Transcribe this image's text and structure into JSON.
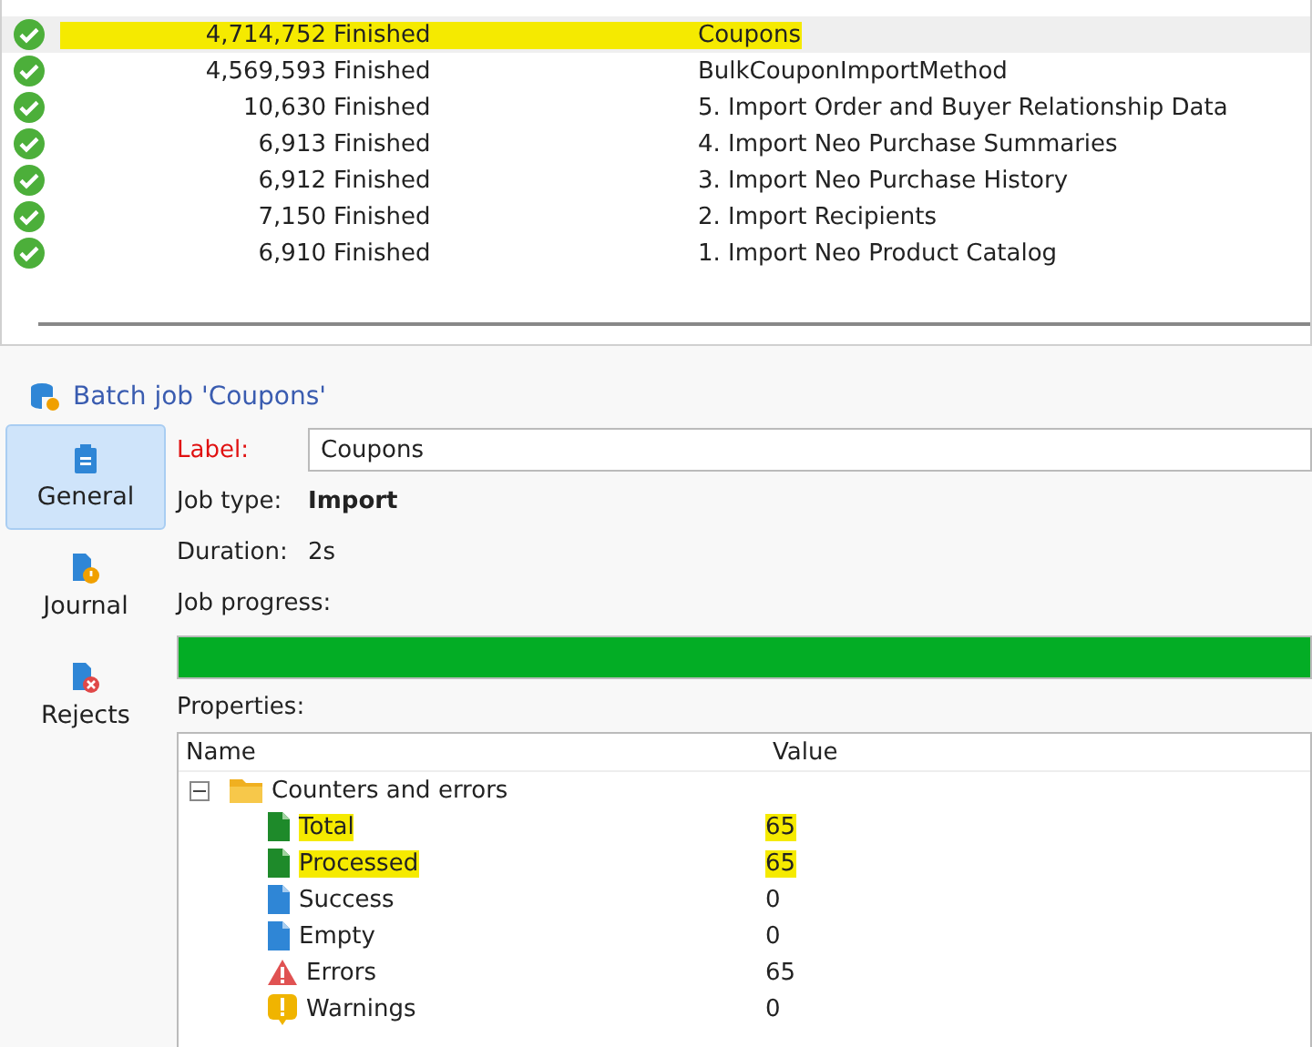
{
  "jobs": [
    {
      "kind": "success",
      "count": "4,714,752",
      "state": "Finished",
      "label": "Coupons",
      "selected": true,
      "highlighted": true
    },
    {
      "kind": "success",
      "count": "4,569,593",
      "state": "Finished",
      "label": "BulkCouponImportMethod",
      "selected": false,
      "highlighted": false
    },
    {
      "kind": "success",
      "count": "10,630",
      "state": "Finished",
      "label": "5. Import Order and Buyer Relationship Data",
      "selected": false,
      "highlighted": false
    },
    {
      "kind": "success",
      "count": "6,913",
      "state": "Finished",
      "label": "4. Import Neo Purchase Summaries",
      "selected": false,
      "highlighted": false
    },
    {
      "kind": "success",
      "count": "6,912",
      "state": "Finished",
      "label": "3. Import Neo Purchase History",
      "selected": false,
      "highlighted": false
    },
    {
      "kind": "success",
      "count": "7,150",
      "state": "Finished",
      "label": "2. Import Recipients",
      "selected": false,
      "highlighted": false
    },
    {
      "kind": "success",
      "count": "6,910",
      "state": "Finished",
      "label": "1. Import Neo Product Catalog",
      "selected": false,
      "highlighted": false
    }
  ],
  "detail_title": "Batch job 'Coupons'",
  "tabs": [
    {
      "label": "General",
      "kind": "general",
      "selected": true
    },
    {
      "label": "Journal",
      "kind": "journal",
      "selected": false
    },
    {
      "label": "Rejects",
      "kind": "rejects",
      "selected": false
    }
  ],
  "form": {
    "label_caption": "Label:",
    "label_value": "Coupons",
    "job_type_caption": "Job type:",
    "job_type": "Import",
    "duration_caption": "Duration:",
    "duration": "2s",
    "progress_caption": "Job progress:",
    "progress": {
      "level": 1
    },
    "properties_caption": "Properties:"
  },
  "properties": {
    "columns": [
      "Name",
      "Value"
    ],
    "group": {
      "name": "Counters and errors",
      "expanded": true,
      "highlighted": false,
      "children": [
        {
          "name": "Total",
          "value": "65",
          "kind": "green",
          "highlighted": true
        },
        {
          "name": "Processed",
          "value": "65",
          "kind": "green",
          "highlighted": true
        },
        {
          "name": "Success",
          "value": "0",
          "kind": "blue",
          "highlighted": false
        },
        {
          "name": "Empty",
          "value": "0",
          "kind": "blue",
          "highlighted": false
        },
        {
          "name": "Errors",
          "value": "65",
          "kind": "error",
          "highlighted": false
        },
        {
          "name": "Warnings",
          "value": "0",
          "kind": "warning",
          "highlighted": false
        }
      ]
    }
  }
}
